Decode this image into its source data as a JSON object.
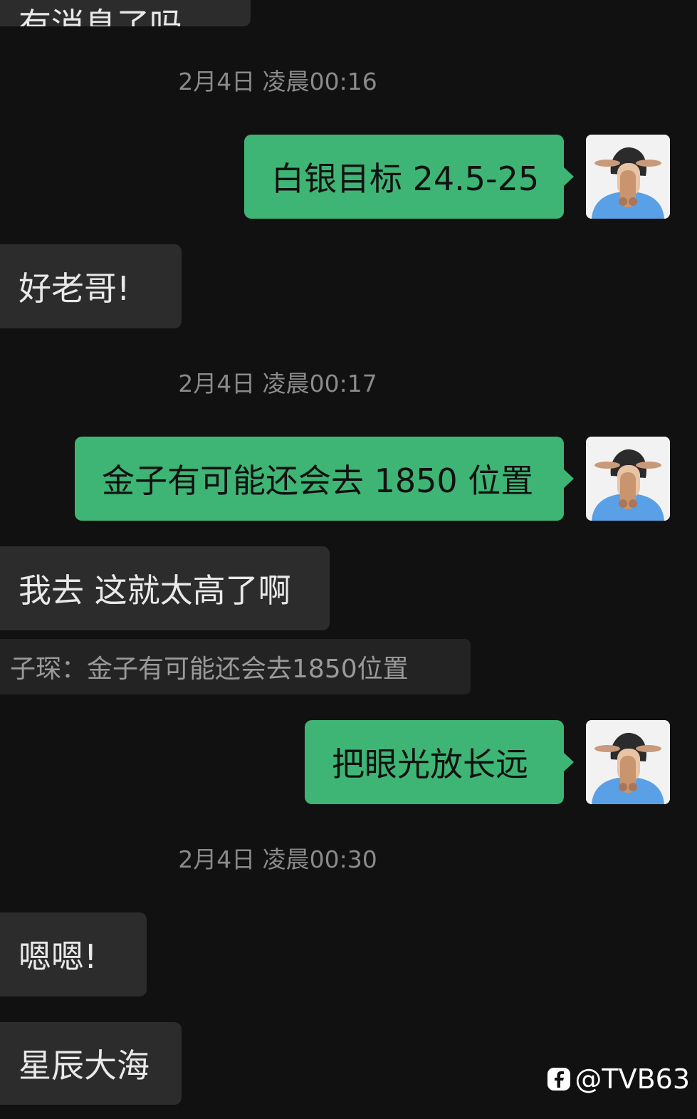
{
  "chat": {
    "top_partial_message": "有消息了吗",
    "timestamp_1": "2月4日 凌晨00:16",
    "msg_out_1": "白银目标 24.5-25",
    "msg_in_1": "好老哥!",
    "timestamp_2": "2月4日 凌晨00:17",
    "msg_out_2": "金子有可能还会去 1850 位置",
    "msg_in_2": "我去 这就太高了啊",
    "quote_text": "子琛：金子有可能还会去1850位置",
    "msg_out_3": "把眼光放长远",
    "timestamp_3": "2月4日 凌晨00:30",
    "msg_in_3": "嗯嗯!",
    "msg_in_4": "星辰大海"
  },
  "watermark": {
    "handle": "@TVB63",
    "icon": "facebook-icon"
  },
  "colors": {
    "background": "#111111",
    "incoming_bubble": "#2c2c2c",
    "outgoing_bubble": "#3eb575",
    "timestamp_text": "#8a8a8a"
  }
}
